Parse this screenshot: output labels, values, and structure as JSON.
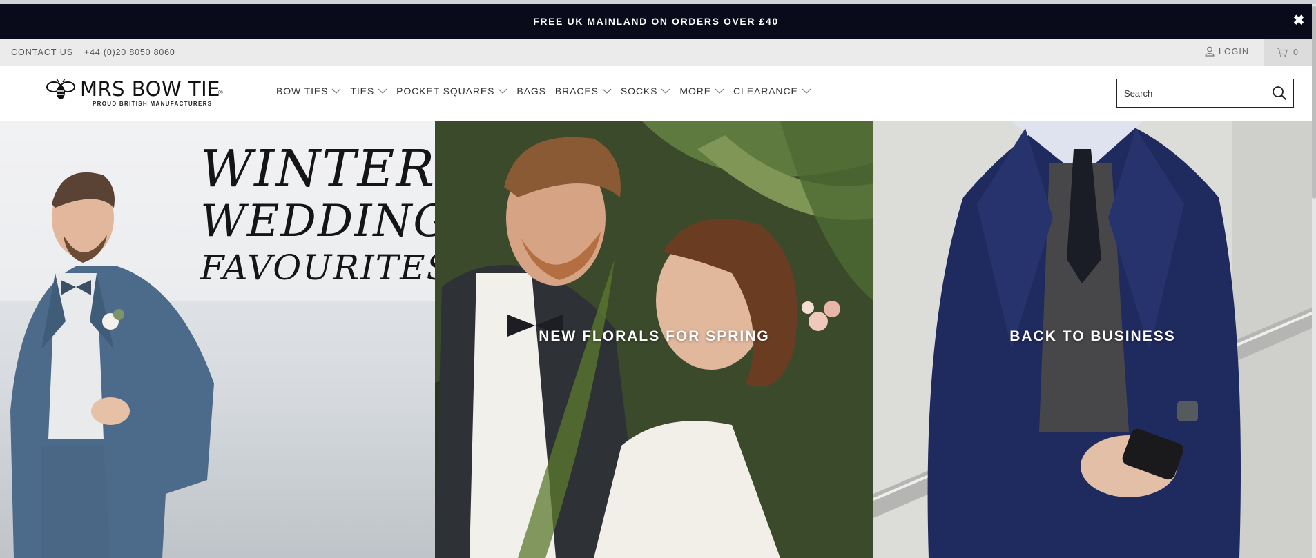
{
  "announcement": {
    "text": "FREE UK MAINLAND ON ORDERS OVER £40",
    "close_symbol": "✖"
  },
  "topbar": {
    "contact_label": "CONTACT US",
    "phone": "+44 (0)20 8050 8060",
    "login_label": "LOGIN",
    "cart_count": "0"
  },
  "logo": {
    "name": "MRS BOW TIE",
    "registered": "®",
    "tagline": "PROUD BRITISH MANUFACTURERS"
  },
  "nav": {
    "items": [
      {
        "label": "BOW TIES",
        "has_dropdown": true
      },
      {
        "label": "TIES",
        "has_dropdown": true
      },
      {
        "label": "POCKET SQUARES",
        "has_dropdown": true
      },
      {
        "label": "BAGS",
        "has_dropdown": false
      },
      {
        "label": "BRACES",
        "has_dropdown": true
      },
      {
        "label": "SOCKS",
        "has_dropdown": true
      },
      {
        "label": "MORE",
        "has_dropdown": true
      },
      {
        "label": "CLEARANCE",
        "has_dropdown": true
      }
    ]
  },
  "search": {
    "placeholder": "Search"
  },
  "hero": {
    "panel1": {
      "line1": "WINTER",
      "line2": "WEDDING",
      "line3": "FAVOURITES"
    },
    "panel2": {
      "caption": "NEW FLORALS FOR SPRING"
    },
    "panel3": {
      "caption": "BACK TO BUSINESS"
    }
  },
  "colors": {
    "announcement_bg": "#0a0b1a",
    "topbar_bg": "#ebebeb",
    "cart_bg": "#dcdcdc"
  }
}
